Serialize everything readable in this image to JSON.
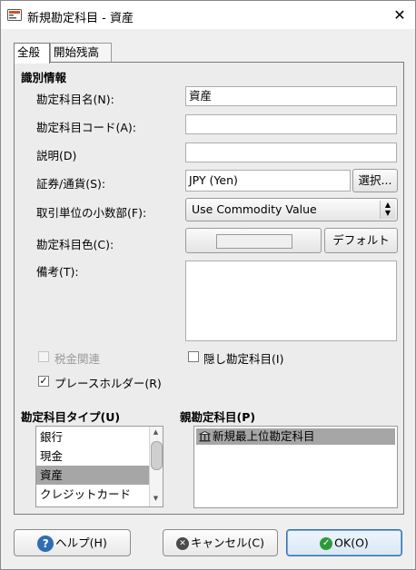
{
  "window": {
    "title": "新規勘定科目 - 資産"
  },
  "tabs": [
    "全般",
    "開始残高"
  ],
  "section_title": "識別情報",
  "fields": {
    "account_name": {
      "label": "勘定科目名(N):",
      "value": "資産"
    },
    "account_code": {
      "label": "勘定科目コード(A):",
      "value": ""
    },
    "description": {
      "label": "説明(D)",
      "value": ""
    },
    "security": {
      "label": "証券/通貨(S):",
      "value": "JPY (Yen)",
      "button": "選択..."
    },
    "smallest_fraction": {
      "label": "取引単位の小数部(F):",
      "value": "Use Commodity Value"
    },
    "account_color": {
      "label": "勘定科目色(C):",
      "button": "デフォルト"
    },
    "notes": {
      "label": "備考(T):",
      "value": ""
    }
  },
  "checkboxes": {
    "tax_related": {
      "label": "税金関連",
      "checked": false,
      "disabled": true
    },
    "hidden": {
      "label": "隠し勘定科目(I)",
      "checked": false
    },
    "placeholder": {
      "label": "プレースホルダー(R)",
      "checked": true
    }
  },
  "account_type": {
    "title": "勘定科目タイプ(U)",
    "items": [
      "銀行",
      "現金",
      "資産",
      "クレジットカード"
    ],
    "selected": "資産"
  },
  "parent_account": {
    "title": "親勘定科目(P)",
    "items": [
      "新規最上位勘定科目"
    ]
  },
  "buttons": {
    "help": "ヘルプ(H)",
    "cancel": "キャンセル(C)",
    "ok": "OK(O)"
  },
  "colors": {
    "selection": "#a6a6a6",
    "ok_border": "#3c6fa0"
  }
}
